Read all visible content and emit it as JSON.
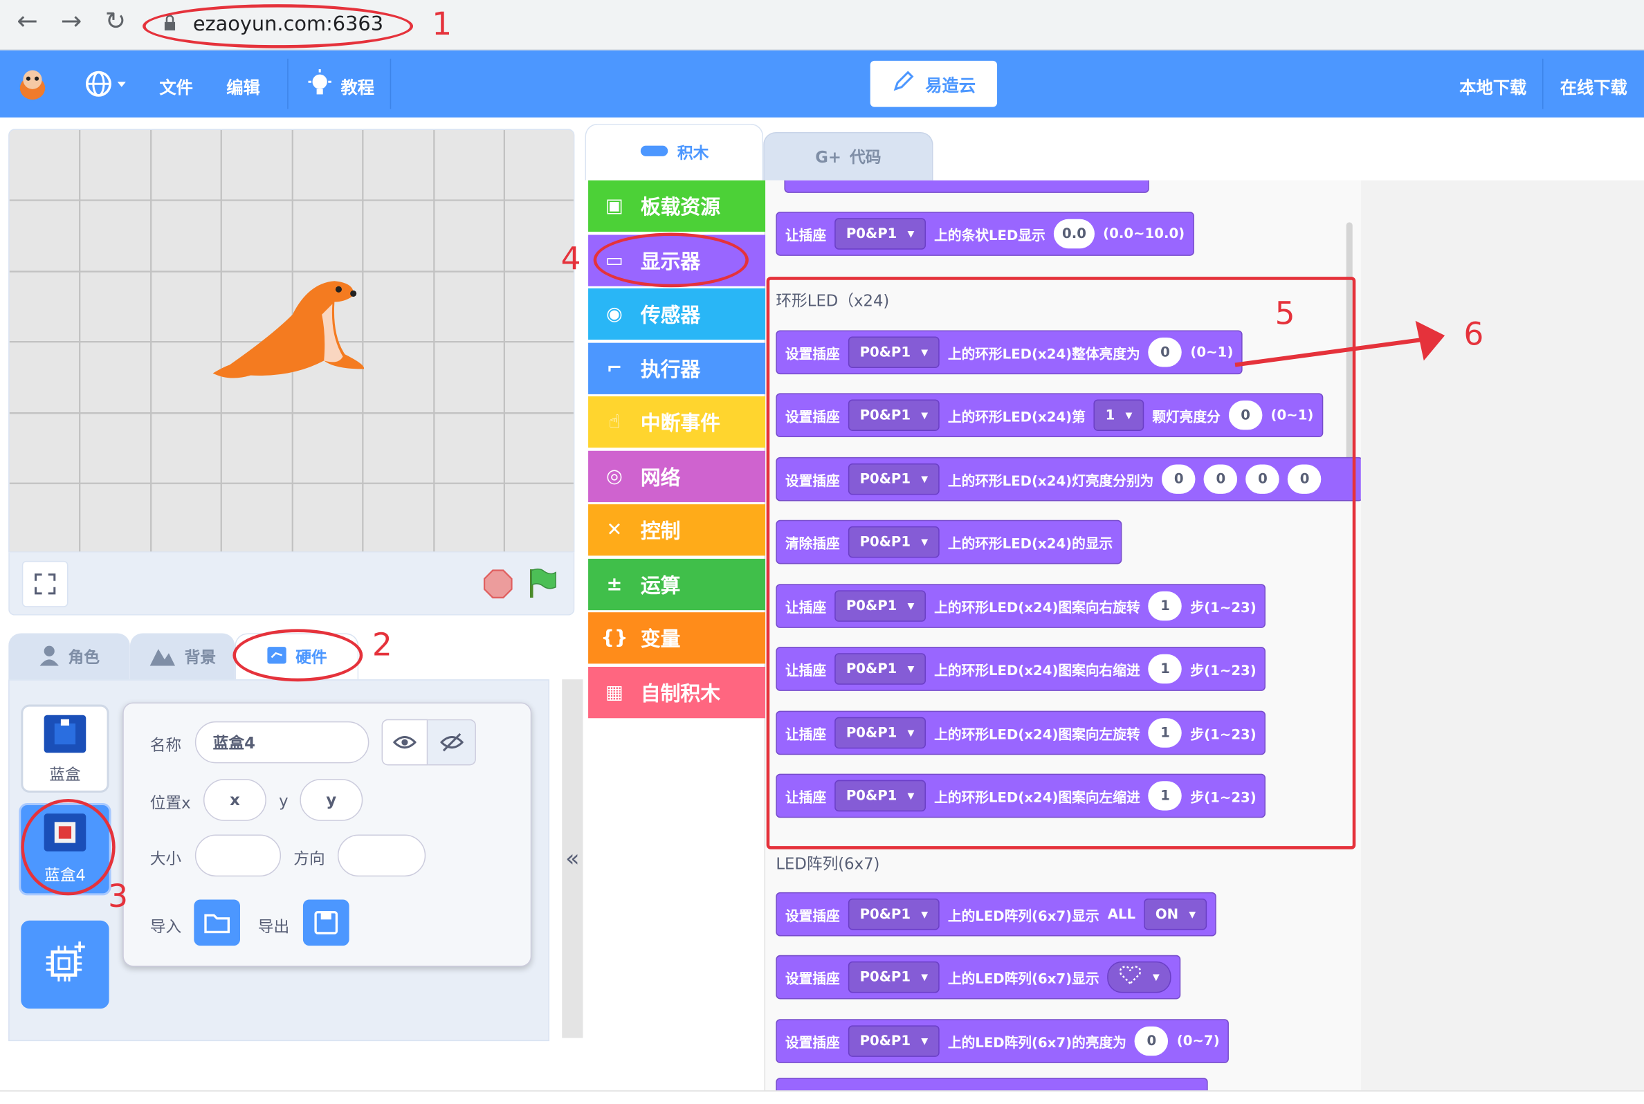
{
  "browser": {
    "url": "ezaoyun.com:6363"
  },
  "header": {
    "menu_file": "文件",
    "menu_edit": "编辑",
    "menu_tutorial": "教程",
    "brand": "易造云",
    "local_download": "本地下载",
    "online_download": "在线下载"
  },
  "left_tabs": {
    "sprite": "角色",
    "backdrop": "背景",
    "hardware": "硬件"
  },
  "sprites": [
    {
      "name": "蓝盒"
    },
    {
      "name": "蓝盒4"
    }
  ],
  "props": {
    "name_label": "名称",
    "name_value": "蓝盒4",
    "pos_label": "位置x",
    "x_placeholder": "x",
    "y_label": "y",
    "y_placeholder": "y",
    "size_label": "大小",
    "dir_label": "方向",
    "import_label": "导入",
    "export_label": "导出"
  },
  "palette_tabs": {
    "blocks": "积木",
    "code": "代码"
  },
  "categories": [
    {
      "label": "板载资源",
      "color": "#4cd137"
    },
    {
      "label": "显示器",
      "color": "#9966ff"
    },
    {
      "label": "传感器",
      "color": "#29b6f6"
    },
    {
      "label": "执行器",
      "color": "#4c97ff"
    },
    {
      "label": "中断事件",
      "color": "#ffd52e"
    },
    {
      "label": "网络",
      "color": "#cf63cf"
    },
    {
      "label": "控制",
      "color": "#ffab19"
    },
    {
      "label": "运算",
      "color": "#40bf4a"
    },
    {
      "label": "变量",
      "color": "#ff8c1a"
    },
    {
      "label": "自制积木",
      "color": "#ff6680"
    }
  ],
  "blocks": {
    "bar": {
      "a": "让插座",
      "port": "P0&P1",
      "b": "上的条状LED显示",
      "v": "0.0",
      "range": "(0.0~10.0)"
    },
    "ring_section": "环形LED（x24)",
    "ring1": {
      "a": "设置插座",
      "port": "P0&P1",
      "b": "上的环形LED(x24)整体亮度为",
      "v": "0",
      "range": "(0~1)"
    },
    "ring2": {
      "a": "设置插座",
      "port": "P0&P1",
      "b": "上的环形LED(x24)第",
      "idx": "1",
      "c": "颗灯亮度分",
      "v": "0",
      "range": "(0~1)"
    },
    "ring3": {
      "a": "设置插座",
      "port": "P0&P1",
      "b": "上的环形LED(x24)灯亮度分别为",
      "v1": "0",
      "v2": "0",
      "v3": "0",
      "v4": "0"
    },
    "ring4": {
      "a": "清除插座",
      "port": "P0&P1",
      "b": "上的环形LED(x24)的显示"
    },
    "ring5": {
      "a": "让插座",
      "port": "P0&P1",
      "b": "上的环形LED(x24)图案向右旋转",
      "v": "1",
      "range": "步(1~23)"
    },
    "ring6": {
      "a": "让插座",
      "port": "P0&P1",
      "b": "上的环形LED(x24)图案向右缩进",
      "v": "1",
      "range": "步(1~23)"
    },
    "ring7": {
      "a": "让插座",
      "port": "P0&P1",
      "b": "上的环形LED(x24)图案向左旋转",
      "v": "1",
      "range": "步(1~23)"
    },
    "ring8": {
      "a": "让插座",
      "port": "P0&P1",
      "b": "上的环形LED(x24)图案向左缩进",
      "v": "1",
      "range": "步(1~23)"
    },
    "matrix_section": "LED阵列(6x7)",
    "m1": {
      "a": "设置插座",
      "port": "P0&P1",
      "b": "上的LED阵列(6x7)显示",
      "c": "ALL",
      "v": "ON"
    },
    "m2": {
      "a": "设置插座",
      "port": "P0&P1",
      "b": "上的LED阵列(6x7)显示"
    },
    "m3": {
      "a": "设置插座",
      "port": "P0&P1",
      "b": "上的LED阵列(6x7)的亮度为",
      "v": "0",
      "range": "(0~7)"
    }
  },
  "annotations": [
    "1",
    "2",
    "3",
    "4",
    "5",
    "6"
  ],
  "colors": {
    "accent": "#4c97ff",
    "annotation": "#e5323b",
    "block_looks": "#9966ff"
  }
}
